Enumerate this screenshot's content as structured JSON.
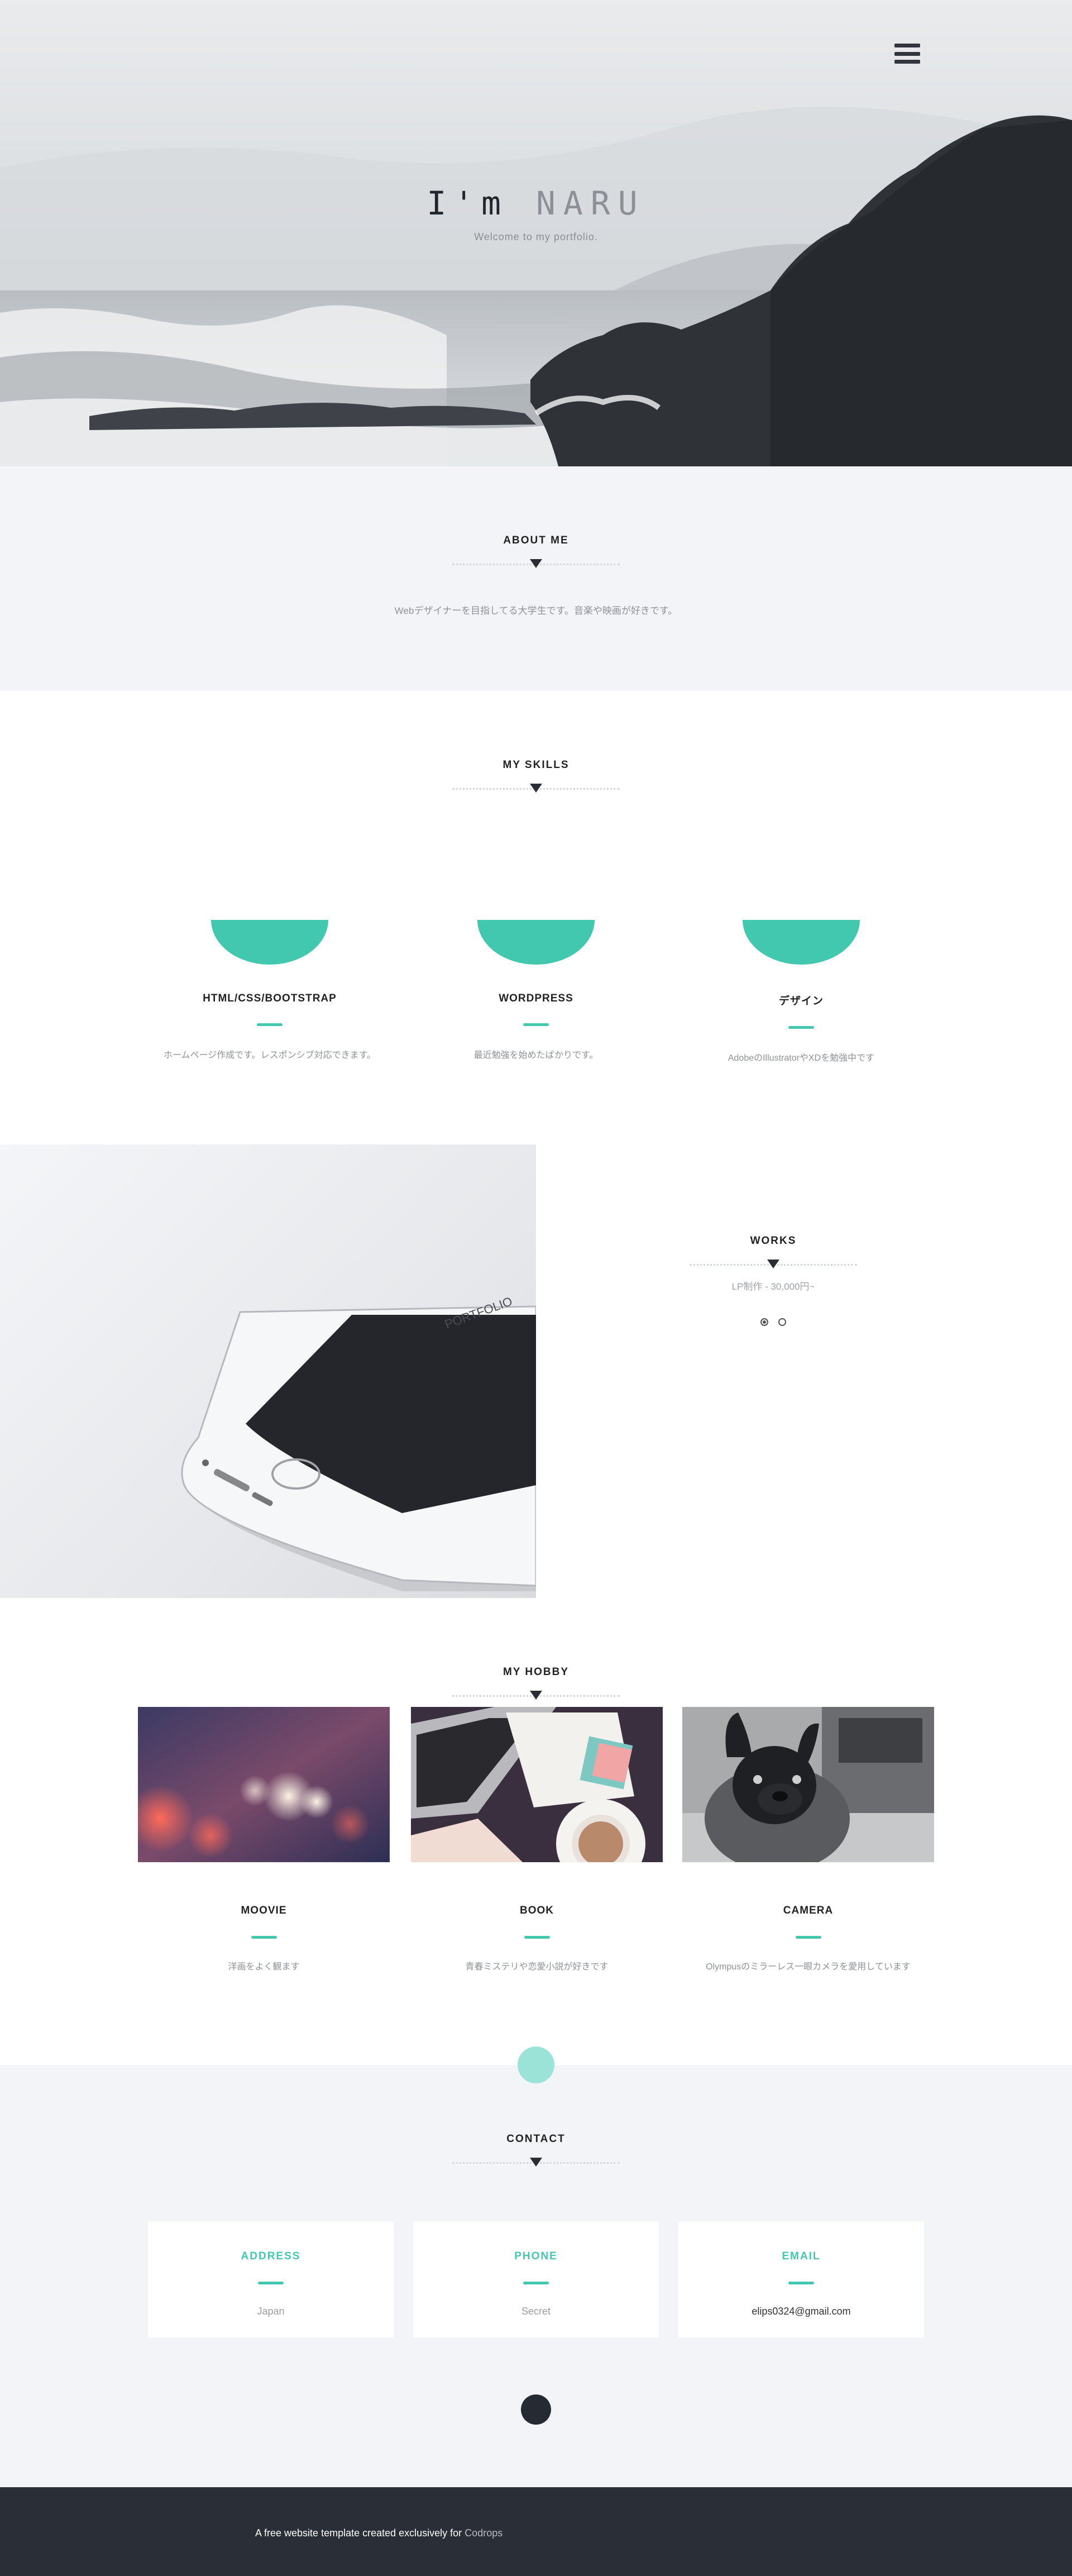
{
  "hero": {
    "title_prefix": "I'm",
    "title_name": "NARU",
    "subtitle": "Welcome to my portfolio.",
    "menu_icon": "hamburger-menu-icon"
  },
  "about": {
    "title": "ABOUT ME",
    "text": "Webデザイナーを目指してる大学生です。音楽や映画が好きです。"
  },
  "skills": {
    "title": "MY SKILLS",
    "accent_color": "#43c8b0",
    "items": [
      {
        "name": "HTML/CSS/BOOTSTRAP",
        "desc": "ホームページ作成です。レスポンシブ対応できます。"
      },
      {
        "name": "WORDPRESS",
        "desc": "最近勉強を始めたばかりです。"
      },
      {
        "name": "デザイン",
        "desc": "AdobeのIllustratorやXDを勉強中です"
      }
    ]
  },
  "works": {
    "title": "WORKS",
    "subtitle": "LP制作 - 30,000円~",
    "slide_count": 2,
    "active_slide": 1
  },
  "hobby": {
    "title": "MY HOBBY",
    "items": [
      {
        "name": "MOOVIE",
        "desc": "洋画をよく観ます"
      },
      {
        "name": "BOOK",
        "desc": "青春ミステリや恋愛小説が好きです"
      },
      {
        "name": "CAMERA",
        "desc": "Olympusのミラーレス一眼カメラを愛用しています"
      }
    ]
  },
  "contact": {
    "title": "CONTACT",
    "items": [
      {
        "label": "ADDRESS",
        "value": "Japan"
      },
      {
        "label": "PHONE",
        "value": "Secret"
      },
      {
        "label": "EMAIL",
        "value": "elips0324@gmail.com"
      }
    ]
  },
  "footer": {
    "text": "A free website template created exclusively for ",
    "link": "Codrops"
  },
  "colors": {
    "accent": "#43c8b0",
    "light_bg": "#f3f4f7",
    "footer_bg": "#2a2e37"
  }
}
